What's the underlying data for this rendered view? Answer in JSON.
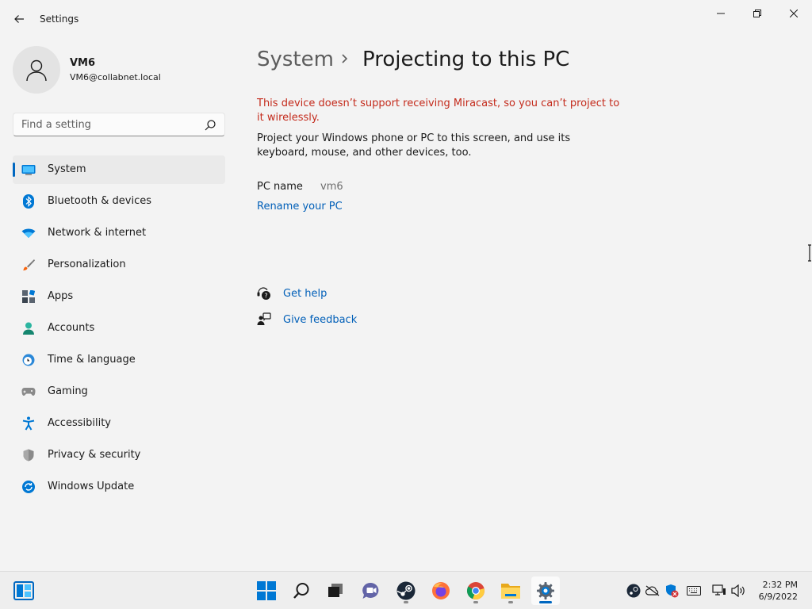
{
  "window": {
    "app_title": "Settings",
    "controls": {
      "minimize": "minimize-icon",
      "maximize": "restore-icon",
      "close": "close-icon"
    }
  },
  "profile": {
    "name": "VM6",
    "email": "VM6@collabnet.local"
  },
  "search": {
    "placeholder": "Find a setting"
  },
  "sidebar": {
    "items": [
      {
        "label": "System",
        "icon": "system-icon",
        "selected": true
      },
      {
        "label": "Bluetooth & devices",
        "icon": "bluetooth-icon"
      },
      {
        "label": "Network & internet",
        "icon": "wifi-icon"
      },
      {
        "label": "Personalization",
        "icon": "brush-icon"
      },
      {
        "label": "Apps",
        "icon": "apps-icon"
      },
      {
        "label": "Accounts",
        "icon": "account-icon"
      },
      {
        "label": "Time & language",
        "icon": "clock-globe-icon"
      },
      {
        "label": "Gaming",
        "icon": "controller-icon"
      },
      {
        "label": "Accessibility",
        "icon": "accessibility-icon"
      },
      {
        "label": "Privacy & security",
        "icon": "shield-icon"
      },
      {
        "label": "Windows Update",
        "icon": "update-icon"
      }
    ]
  },
  "main": {
    "breadcrumb_parent": "System",
    "breadcrumb_current": "Projecting to this PC",
    "error_message": "This device doesn’t support receiving Miracast, so you can’t project to it wirelessly.",
    "description": "Project your Windows phone or PC to this screen, and use its keyboard, mouse, and other devices, too.",
    "pc_name_label": "PC name",
    "pc_name_value": "vm6",
    "rename_link": "Rename your PC",
    "get_help": "Get help",
    "give_feedback": "Give feedback"
  },
  "taskbar": {
    "pinned": [
      "start-icon",
      "search-icon",
      "task-view-icon",
      "chat-icon",
      "steam-icon",
      "firefox-icon",
      "chrome-icon",
      "file-explorer-icon",
      "settings-icon"
    ],
    "tray": [
      "steam-tray-icon",
      "onedrive-icon",
      "security-icon",
      "keyboard-icon",
      "network-icon",
      "volume-icon"
    ],
    "time": "2:32 PM",
    "date": "6/9/2022"
  },
  "colors": {
    "accent": "#0067c0",
    "link": "#005fb8",
    "error": "#c42b1c",
    "background": "#f3f3f3"
  }
}
